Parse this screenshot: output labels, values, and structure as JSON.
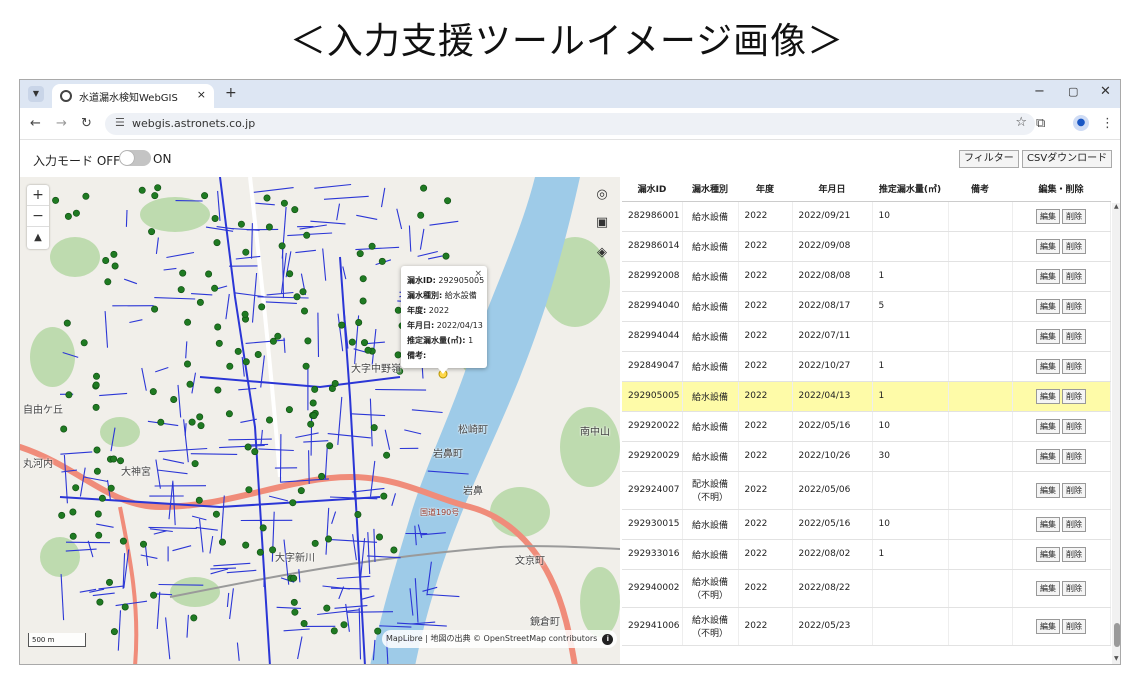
{
  "page": {
    "title": "＜入力支援ツールイメージ画像＞"
  },
  "browser": {
    "tab_title": "水道漏水検知WebGIS",
    "url": "webgis.astronets.co.jp",
    "tab_dropdown_icon": "chevron-down-icon",
    "new_tab_label": "+",
    "close_label": "×",
    "minimize_label": "−",
    "maximize_label": "▢",
    "window_close_label": "✕"
  },
  "toolbar": {
    "mode_label_off": "入力モード OFF",
    "mode_label_on": "ON",
    "toggle_on": false,
    "filter_label": "フィルター",
    "csv_label": "CSVダウンロード"
  },
  "map": {
    "labels": {
      "oaza_nakanoaki": "大字中野嶺",
      "jiyugaoka": "自由ケ丘",
      "maruhe": "丸河内",
      "daiba": "大神宮",
      "matsuzaki": "松崎町",
      "iwahana": "岩鼻町",
      "minaminaka": "南中山",
      "bunkyo": "文京町",
      "kagami": "鏡倉町",
      "oaza_shinkawa": "大字新川",
      "iwahana2": "岩鼻",
      "national_road": "国道190号"
    },
    "scale_label": "500 m",
    "attribution": "MapLibre | 地図の出典 © OpenStreetMap contributors",
    "attribution_icon": "i",
    "popup": {
      "id_label": "漏水ID:",
      "id_value": "292905005",
      "type_label": "漏水種別:",
      "type_value": "給水設備",
      "year_label": "年度:",
      "year_value": "2022",
      "date_label": "年月日:",
      "date_value": "2022/04/13",
      "volume_label": "推定漏水量(㎥):",
      "volume_value": "1",
      "note_label": "備考:",
      "note_value": ""
    }
  },
  "table": {
    "headers": [
      "漏水ID",
      "漏水種別",
      "年度",
      "年月日",
      "推定漏水量(㎥)",
      "備考",
      "編集・削除"
    ],
    "edit_label": "編集",
    "delete_label": "削除",
    "rows": [
      {
        "id": "282986001",
        "type": "給水設備",
        "type2": "",
        "year": "2022",
        "date": "2022/09/21",
        "volume": "10",
        "note": ""
      },
      {
        "id": "282986014",
        "type": "給水設備",
        "type2": "",
        "year": "2022",
        "date": "2022/09/08",
        "volume": "",
        "note": ""
      },
      {
        "id": "282992008",
        "type": "給水設備",
        "type2": "",
        "year": "2022",
        "date": "2022/08/08",
        "volume": "1",
        "note": ""
      },
      {
        "id": "282994040",
        "type": "給水設備",
        "type2": "",
        "year": "2022",
        "date": "2022/08/17",
        "volume": "5",
        "note": ""
      },
      {
        "id": "282994044",
        "type": "給水設備",
        "type2": "",
        "year": "2022",
        "date": "2022/07/11",
        "volume": "",
        "note": ""
      },
      {
        "id": "292849047",
        "type": "給水設備",
        "type2": "",
        "year": "2022",
        "date": "2022/10/27",
        "volume": "1",
        "note": ""
      },
      {
        "id": "292905005",
        "type": "給水設備",
        "type2": "",
        "year": "2022",
        "date": "2022/04/13",
        "volume": "1",
        "note": "",
        "selected": true
      },
      {
        "id": "292920022",
        "type": "給水設備",
        "type2": "",
        "year": "2022",
        "date": "2022/05/16",
        "volume": "10",
        "note": ""
      },
      {
        "id": "292920029",
        "type": "給水設備",
        "type2": "",
        "year": "2022",
        "date": "2022/10/26",
        "volume": "30",
        "note": ""
      },
      {
        "id": "292924007",
        "type": "配水設備",
        "type2": "（不明）",
        "year": "2022",
        "date": "2022/05/06",
        "volume": "",
        "note": ""
      },
      {
        "id": "292930015",
        "type": "給水設備",
        "type2": "",
        "year": "2022",
        "date": "2022/05/16",
        "volume": "10",
        "note": ""
      },
      {
        "id": "292933016",
        "type": "給水設備",
        "type2": "",
        "year": "2022",
        "date": "2022/08/02",
        "volume": "1",
        "note": ""
      },
      {
        "id": "292940002",
        "type": "給水設備",
        "type2": "（不明）",
        "year": "2022",
        "date": "2022/08/22",
        "volume": "",
        "note": ""
      },
      {
        "id": "292941006",
        "type": "給水設備",
        "type2": "（不明）",
        "year": "2022",
        "date": "2022/05/23",
        "volume": "",
        "note": ""
      }
    ]
  },
  "colors": {
    "pipe": "#2b36d6",
    "marker": "#1f7a22",
    "river": "#9ecbe8",
    "forest": "#b5d7a5",
    "main_road": "#f08c7a",
    "selected_row": "#fefba8"
  }
}
